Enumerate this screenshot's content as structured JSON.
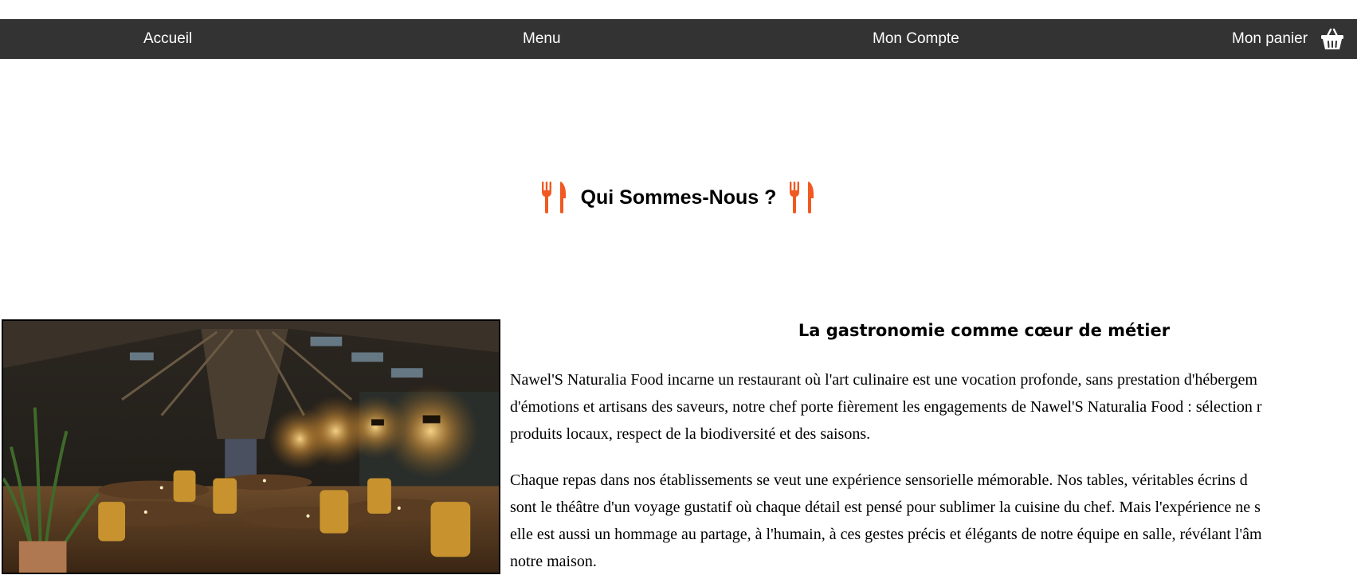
{
  "nav": {
    "accueil": "Accueil",
    "menu": "Menu",
    "compte": "Mon Compte",
    "panier": "Mon panier",
    "cart_icon": "basket-icon"
  },
  "heading": {
    "text": "Qui Sommes-Nous ?",
    "icon": "fork-knife-icon",
    "icon_color": "#f05a22"
  },
  "about": {
    "subtitle": "La gastronomie comme cœur de métier",
    "paragraph1": [
      "Nawel'S Naturalia Food incarne un restaurant où l'art culinaire est une vocation profonde, sans prestation d'hébergem",
      "d'émotions et artisans des saveurs, notre chef porte fièrement les engagements de Nawel'S Naturalia Food : sélection r",
      "produits locaux, respect de la biodiversité et des saisons."
    ],
    "paragraph2": [
      "Chaque repas dans nos établissements se veut une expérience sensorielle mémorable. Nos tables, véritables écrins d",
      "sont le théâtre d'un voyage gustatif où chaque détail est pensé pour sublimer la cuisine du chef. Mais l'expérience ne s",
      "elle est aussi un hommage au partage, à l'humain, à ces gestes précis et élégants de notre équipe en salle, révélant l'âm",
      "notre maison."
    ]
  },
  "colors": {
    "navbar": "#333333",
    "accent": "#f05a22"
  }
}
